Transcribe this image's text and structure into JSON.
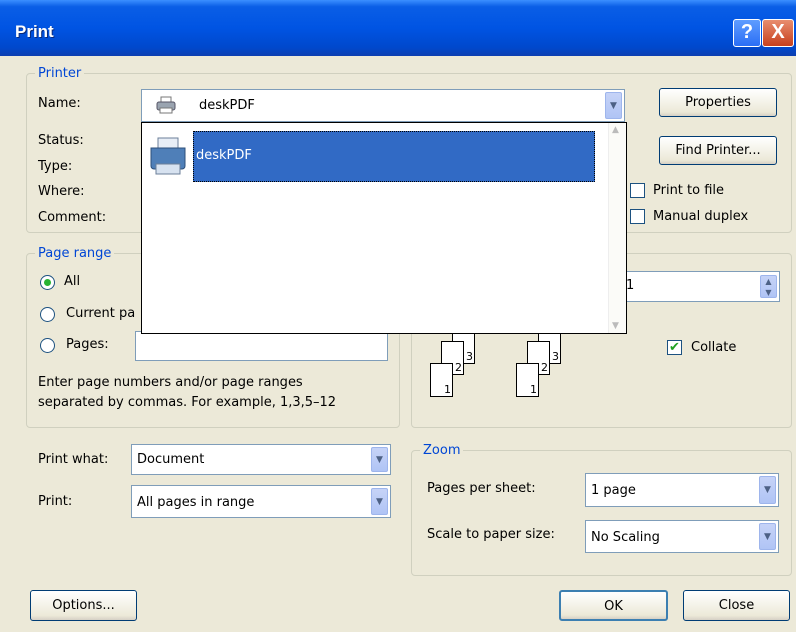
{
  "window": {
    "title": "Print",
    "help_glyph": "?",
    "close_glyph": "X"
  },
  "printer": {
    "legend": "Printer",
    "name_label": "Name:",
    "status_label": "Status:",
    "type_label": "Type:",
    "where_label": "Where:",
    "comment_label": "Comment:",
    "selected": "deskPDF",
    "dropdown_items": [
      "deskPDF"
    ],
    "properties_button": "Properties",
    "find_printer_button": "Find Printer...",
    "print_to_file_label": "Print to file",
    "manual_duplex_label": "Manual duplex"
  },
  "page_range": {
    "legend": "Page range",
    "all_label": "All",
    "current_label": "Current pa",
    "pages_label": "Pages:",
    "help_line1": "Enter page numbers and/or page ranges",
    "help_line2": "separated by commas.  For example, 1,3,5–12"
  },
  "copies": {
    "value": "1",
    "collate_label": "Collate",
    "collate_checked": true,
    "page_numbers": [
      "1",
      "2",
      "3"
    ]
  },
  "print_what": {
    "label": "Print what:",
    "value": "Document"
  },
  "print": {
    "label": "Print:",
    "value": "All pages in range"
  },
  "zoom": {
    "legend": "Zoom",
    "pages_per_sheet_label": "Pages per sheet:",
    "pages_per_sheet_value": "1 page",
    "scale_label": "Scale to paper size:",
    "scale_value": "No Scaling"
  },
  "buttons": {
    "options": "Options...",
    "ok": "OK",
    "close": "Close"
  },
  "colors": {
    "titlebar": "#0054e3",
    "selection": "#316ac5",
    "legend_text": "#0046d5",
    "check_green": "#21a121"
  }
}
